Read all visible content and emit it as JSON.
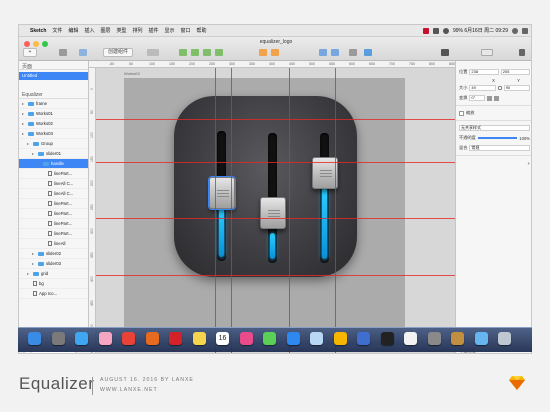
{
  "menubar": {
    "app_name": "Sketch",
    "menus": [
      "文件",
      "编辑",
      "插入",
      "图层",
      "类型",
      "排列",
      "插件",
      "显示",
      "窗口",
      "帮助"
    ],
    "status_text": "99% 6月16日 周二 09:29"
  },
  "window": {
    "title": "equalizer_logo",
    "toolbar_button": "创建组件"
  },
  "layers": {
    "pages_header": "页面",
    "current_page": "Untitled",
    "page_section": "Equalizer",
    "rows": [
      {
        "label": "frame",
        "indent": 0,
        "kind": "folder",
        "selected": false
      },
      {
        "label": "Works01",
        "indent": 0,
        "kind": "folder",
        "selected": false
      },
      {
        "label": "Works02",
        "indent": 0,
        "kind": "folder",
        "selected": false
      },
      {
        "label": "Works03",
        "indent": 0,
        "kind": "folder",
        "selected": false
      },
      {
        "label": "Group",
        "indent": 1,
        "kind": "folder",
        "selected": false
      },
      {
        "label": "slider01",
        "indent": 2,
        "kind": "folder",
        "selected": false
      },
      {
        "label": "handle",
        "indent": 3,
        "kind": "folder",
        "selected": true
      },
      {
        "label": "linePart...",
        "indent": 4,
        "kind": "shape",
        "selected": false
      },
      {
        "label": "lineAll C...",
        "indent": 4,
        "kind": "shape",
        "selected": false
      },
      {
        "label": "lineAll C...",
        "indent": 4,
        "kind": "shape",
        "selected": false
      },
      {
        "label": "linePart...",
        "indent": 4,
        "kind": "shape",
        "selected": false
      },
      {
        "label": "linePart...",
        "indent": 4,
        "kind": "shape",
        "selected": false
      },
      {
        "label": "linePart...",
        "indent": 4,
        "kind": "shape",
        "selected": false
      },
      {
        "label": "linePart...",
        "indent": 4,
        "kind": "shape",
        "selected": false
      },
      {
        "label": "lineAll",
        "indent": 4,
        "kind": "shape",
        "selected": false
      },
      {
        "label": "slider02",
        "indent": 2,
        "kind": "folder",
        "selected": false
      },
      {
        "label": "slider03",
        "indent": 2,
        "kind": "folder",
        "selected": false
      },
      {
        "label": "grid",
        "indent": 1,
        "kind": "folder",
        "selected": false
      },
      {
        "label": "bg",
        "indent": 1,
        "kind": "shape",
        "selected": false
      },
      {
        "label": "App Ico...",
        "indent": 1,
        "kind": "shape",
        "selected": false
      }
    ],
    "search_placeholder": "Q"
  },
  "canvas": {
    "artboard_label": "Works03",
    "ruler_top": [
      "-50",
      "50",
      "100",
      "150",
      "200",
      "250",
      "300",
      "350",
      "400",
      "450",
      "500",
      "550",
      "600",
      "650",
      "700",
      "750",
      "800",
      "850"
    ],
    "ruler_left": [
      "0",
      "50",
      "100",
      "150",
      "200",
      "250",
      "300",
      "350",
      "400",
      "450",
      "500",
      "550"
    ]
  },
  "inspector": {
    "position_label": "位置",
    "x": "238",
    "y": "205",
    "x_label": "X",
    "y_label": "Y",
    "size_label": "大小",
    "w": "49",
    "h": "90",
    "transform_label": "变换",
    "rotate": "0°",
    "shared_style": "无共享样式",
    "opacity_label": "不透明度",
    "opacity": "100%",
    "blend_label": "混合",
    "blend": "常规",
    "resizing_label": "缩放",
    "footer": "导出图层"
  },
  "dock": {
    "icons": [
      "finder-icon",
      "launchpad-icon",
      "safari-icon",
      "photos-icon",
      "chrome-icon",
      "firefox-icon",
      "opera-icon",
      "notes-icon",
      "calendar-icon",
      "itunes-icon",
      "messages-icon",
      "appstore-icon",
      "preview-icon",
      "sketch-icon",
      "xcode-icon",
      "terminal-icon",
      "qq-icon",
      "settings-icon",
      "misc-icon",
      "folder-icon",
      "trash-icon"
    ],
    "calendar_day": "16"
  },
  "caption": {
    "title": "Equalizer",
    "line1": "AUGUST 16. 2016 BY LANXE",
    "line2": "WWW.LANXE.NET"
  },
  "colors": {
    "accent": "#3d86f5",
    "guide": "#e62828",
    "glow": "#28b6ff",
    "icon_bg": "#3e3e42"
  }
}
